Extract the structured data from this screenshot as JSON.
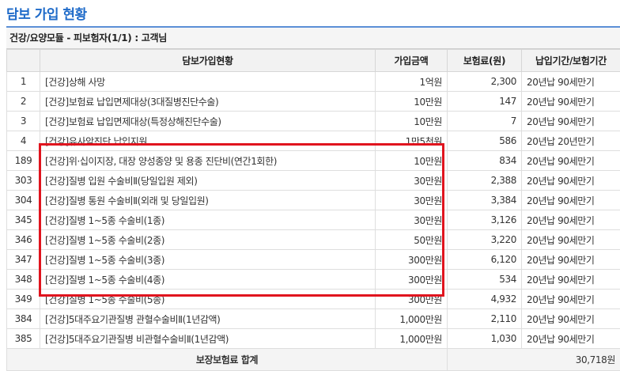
{
  "page_title": "담보 가입 현황",
  "section_header": "건강/요양모듈 - 피보험자(1/1) : 고객님",
  "table": {
    "headers": {
      "no": "",
      "coverage": "담보가입현황",
      "amount": "가입금액",
      "premium": "보험료(원)",
      "term": "납입기간/보험기간"
    },
    "rows": [
      {
        "no": "1",
        "coverage": "[건강]상해 사망",
        "amount": "1억원",
        "premium": "2,300",
        "term": "20년납 90세만기"
      },
      {
        "no": "2",
        "coverage": "[건강]보험료 납입면제대상(3대질병진단수술)",
        "amount": "10만원",
        "premium": "147",
        "term": "20년납 90세만기"
      },
      {
        "no": "3",
        "coverage": "[건강]보험료 납입면제대상(특정상해진단수술)",
        "amount": "10만원",
        "premium": "7",
        "term": "20년납 90세만기"
      },
      {
        "no": "4",
        "coverage": "[건강]유사암진단 납입지원",
        "amount": "1만5천원",
        "premium": "586",
        "term": "20년납 20년만기"
      },
      {
        "no": "189",
        "coverage": "[건강]위·십이지장, 대장 양성종양 및 용종 진단비(연간1회한)",
        "amount": "10만원",
        "premium": "834",
        "term": "20년납 90세만기"
      },
      {
        "no": "303",
        "coverage": "[건강]질병 입원 수술비Ⅱ(당일입원 제외)",
        "amount": "30만원",
        "premium": "2,388",
        "term": "20년납 90세만기"
      },
      {
        "no": "304",
        "coverage": "[건강]질병 통원 수술비Ⅱ(외래 및 당일입원)",
        "amount": "30만원",
        "premium": "3,384",
        "term": "20년납 90세만기"
      },
      {
        "no": "345",
        "coverage": "[건강]질병 1~5종 수술비(1종)",
        "amount": "30만원",
        "premium": "3,126",
        "term": "20년납 90세만기"
      },
      {
        "no": "346",
        "coverage": "[건강]질병 1~5종 수술비(2종)",
        "amount": "50만원",
        "premium": "3,220",
        "term": "20년납 90세만기"
      },
      {
        "no": "347",
        "coverage": "[건강]질병 1~5종 수술비(3종)",
        "amount": "300만원",
        "premium": "6,120",
        "term": "20년납 90세만기"
      },
      {
        "no": "348",
        "coverage": "[건강]질병 1~5종 수술비(4종)",
        "amount": "300만원",
        "premium": "534",
        "term": "20년납 90세만기"
      },
      {
        "no": "349",
        "coverage": "[건강]질병 1~5종 수술비(5종)",
        "amount": "300만원",
        "premium": "4,932",
        "term": "20년납 90세만기"
      },
      {
        "no": "384",
        "coverage": "[건강]5대주요기관질병 관혈수술비Ⅱ(1년감액)",
        "amount": "1,000만원",
        "premium": "2,110",
        "term": "20년납 90세만기"
      },
      {
        "no": "385",
        "coverage": "[건강]5대주요기관질병 비관혈수술비Ⅱ(1년감액)",
        "amount": "1,000만원",
        "premium": "1,030",
        "term": "20년납 90세만기"
      }
    ],
    "total": {
      "label": "보장보험료 합계",
      "value": "30,718원"
    }
  },
  "colors": {
    "title": "#1f6bc9",
    "highlight_border": "#e0141e",
    "total_value": "#e53935"
  }
}
